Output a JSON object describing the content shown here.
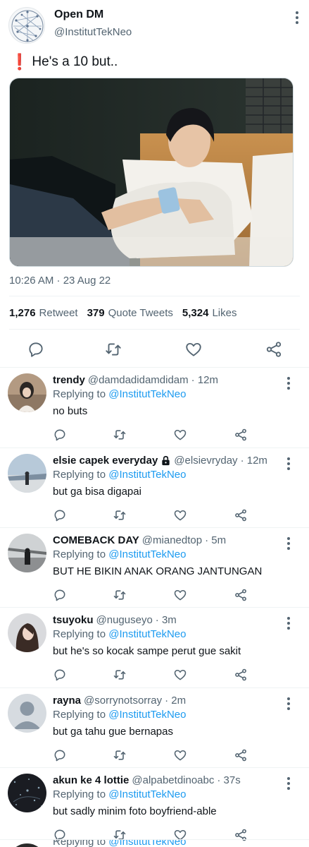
{
  "tweet": {
    "author_name": "Open DM",
    "author_handle": "@InstitutTekNeo",
    "text": "He's a 10 but..",
    "emoji": "❗",
    "timestamp": "10:26 AM · 23 Aug 22",
    "stats": [
      {
        "count": "1,276",
        "label": "Retweet"
      },
      {
        "count": "379",
        "label": "Quote Tweets"
      },
      {
        "count": "5,324",
        "label": "Likes"
      }
    ],
    "actions": [
      "reply-icon",
      "retweet-icon",
      "like-icon",
      "share-icon"
    ]
  },
  "replies": [
    {
      "name": "trendy",
      "handle": "@damdadidamdidam",
      "time": "· 12m",
      "replying_prefix": "Replying to",
      "replying_to": "@InstitutTekNeo",
      "text": "no buts",
      "avatar": "photo",
      "locked": false
    },
    {
      "name": "elsie capek everyday",
      "handle": "@elsievryday",
      "time": "· 12m",
      "replying_prefix": "Replying to",
      "replying_to": "@InstitutTekNeo",
      "text": "but ga bisa digapai",
      "avatar": "photo",
      "locked": true
    },
    {
      "name": "COMEBACK DAY",
      "handle": "@mianedtop",
      "time": "· 5m",
      "replying_prefix": "Replying to",
      "replying_to": "@InstitutTekNeo",
      "text": "BUT HE BIKIN ANAK ORANG JANTUNGAN",
      "avatar": "photo",
      "locked": false
    },
    {
      "name": "tsuyoku",
      "handle": "@nuguseyo",
      "time": "· 3m",
      "replying_prefix": "Replying to",
      "replying_to": "@InstitutTekNeo",
      "text": "but he's so kocak sampe perut gue sakit",
      "avatar": "photo",
      "locked": false
    },
    {
      "name": "rayna",
      "handle": "@sorrynotsorray",
      "time": "· 2m",
      "replying_prefix": "Replying to",
      "replying_to": "@InstitutTekNeo",
      "text": "but ga tahu gue bernapas",
      "avatar": "default-user-icon",
      "locked": false
    },
    {
      "name": "akun ke 4 lottie",
      "handle": "@alpabetdinoabc",
      "time": "· 37s",
      "replying_prefix": "Replying to",
      "replying_to": "@InstitutTekNeo",
      "text": "but sadly minim foto boyfriend-able",
      "avatar": "photo",
      "locked": false
    }
  ],
  "partial_reply": {
    "replying_prefix": "Replying to",
    "replying_to": "@InstitutTekNeo"
  },
  "colors": {
    "link": "#1d9bf0",
    "secondary_text": "#536471",
    "divider": "#eff3f4",
    "emoji_red": "#dd2e44"
  }
}
